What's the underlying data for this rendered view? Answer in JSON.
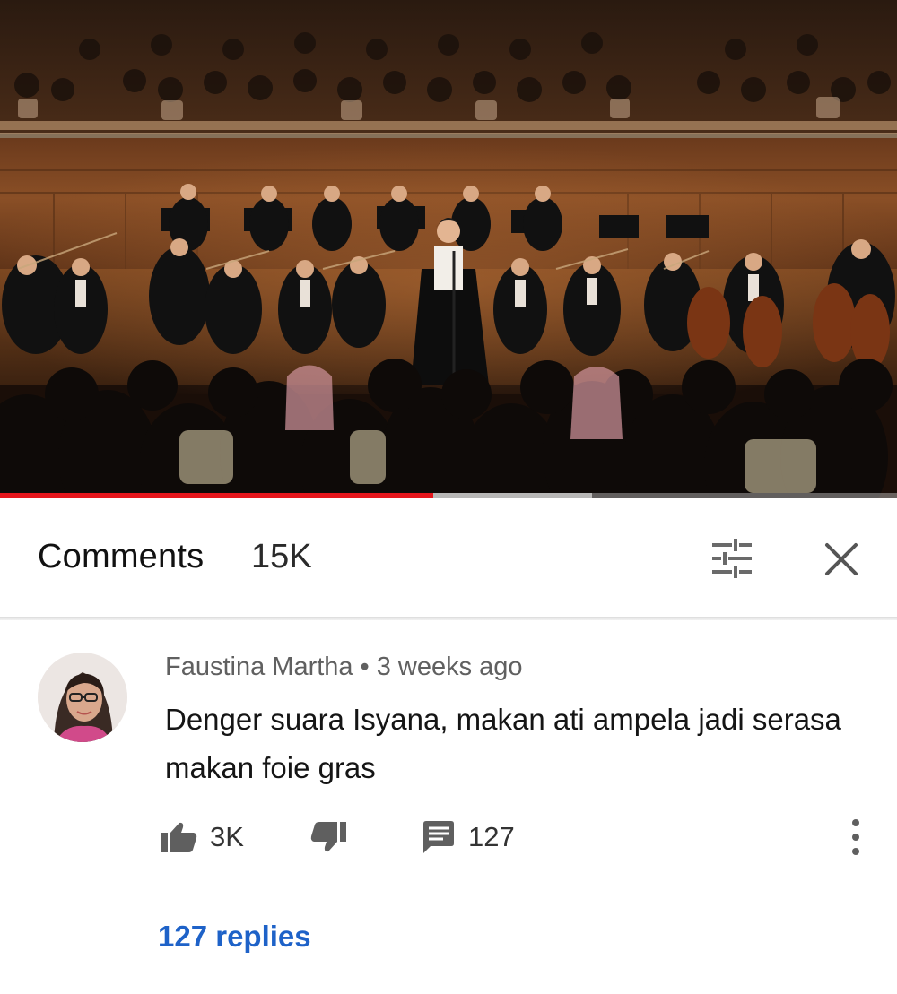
{
  "video": {
    "progress_played": 0.483,
    "progress_buffered": 0.66
  },
  "comments_header": {
    "title": "Comments",
    "count": "15K",
    "filter_icon": "sort-filter-icon",
    "close_icon": "close-icon"
  },
  "comment": {
    "author": "Faustina Martha",
    "separator": "•",
    "time": "3 weeks ago",
    "text": "Denger suara Isyana, makan ati ampela jadi serasa makan foie gras",
    "likes": "3K",
    "reply_count": "127",
    "replies_link": "127 replies"
  },
  "colors": {
    "progress": "#e5161c",
    "link": "#1e62c8"
  }
}
